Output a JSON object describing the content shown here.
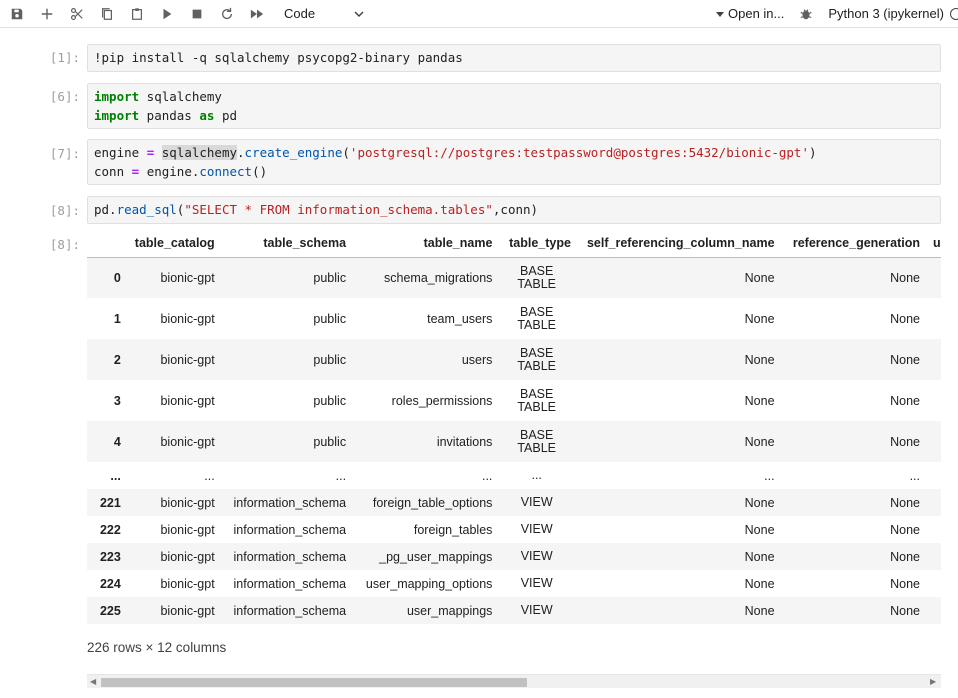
{
  "toolbar": {
    "cell_type": "Code",
    "open_in": "Open in...",
    "kernel": "Python 3 (ipykernel)"
  },
  "cells": [
    {
      "prompt": "[1]:",
      "line1": "!pip install -q sqlalchemy psycopg2-binary pandas"
    },
    {
      "prompt": "[6]:"
    },
    {
      "prompt": "[7]:"
    },
    {
      "prompt": "[8]:"
    }
  ],
  "output": {
    "prompt": "[8]:",
    "columns": [
      "",
      "table_catalog",
      "table_schema",
      "table_name",
      "table_type",
      "self_referencing_column_name",
      "reference_generation",
      "u"
    ],
    "rows": [
      [
        "0",
        "bionic-gpt",
        "public",
        "schema_migrations",
        "BASE",
        "TABLE",
        "None",
        "None"
      ],
      [
        "1",
        "bionic-gpt",
        "public",
        "team_users",
        "BASE",
        "TABLE",
        "None",
        "None"
      ],
      [
        "2",
        "bionic-gpt",
        "public",
        "users",
        "BASE",
        "TABLE",
        "None",
        "None"
      ],
      [
        "3",
        "bionic-gpt",
        "public",
        "roles_permissions",
        "BASE",
        "TABLE",
        "None",
        "None"
      ],
      [
        "4",
        "bionic-gpt",
        "public",
        "invitations",
        "BASE",
        "TABLE",
        "None",
        "None"
      ],
      [
        "...",
        "...",
        "...",
        "...",
        "...",
        "",
        "...",
        "..."
      ],
      [
        "221",
        "bionic-gpt",
        "information_schema",
        "foreign_table_options",
        "VIEW",
        "",
        "None",
        "None"
      ],
      [
        "222",
        "bionic-gpt",
        "information_schema",
        "foreign_tables",
        "VIEW",
        "",
        "None",
        "None"
      ],
      [
        "223",
        "bionic-gpt",
        "information_schema",
        "_pg_user_mappings",
        "VIEW",
        "",
        "None",
        "None"
      ],
      [
        "224",
        "bionic-gpt",
        "information_schema",
        "user_mapping_options",
        "VIEW",
        "",
        "None",
        "None"
      ],
      [
        "225",
        "bionic-gpt",
        "information_schema",
        "user_mappings",
        "VIEW",
        "",
        "None",
        "None"
      ]
    ],
    "summary": "226 rows × 12 columns"
  }
}
